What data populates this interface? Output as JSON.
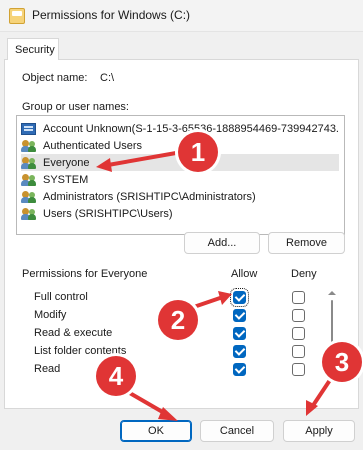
{
  "window": {
    "title": "Permissions for Windows (C:)"
  },
  "tabs": [
    {
      "label": "Security"
    }
  ],
  "object": {
    "label": "Object name:",
    "value": "C:\\"
  },
  "groups": {
    "label": "Group or user names:",
    "items": [
      {
        "label": "Account Unknown(S-1-15-3-65536-1888954469-739942743...",
        "icon": "unknown-account-icon"
      },
      {
        "label": "Authenticated Users",
        "icon": "users-icon"
      },
      {
        "label": "Everyone",
        "icon": "users-icon",
        "selected": true
      },
      {
        "label": "SYSTEM",
        "icon": "users-icon"
      },
      {
        "label": "Administrators (SRISHTIPC\\Administrators)",
        "icon": "users-icon"
      },
      {
        "label": "Users (SRISHTIPC\\Users)",
        "icon": "users-icon"
      }
    ]
  },
  "buttons": {
    "add": "Add...",
    "remove": "Remove",
    "ok": "OK",
    "cancel": "Cancel",
    "apply": "Apply"
  },
  "permissions": {
    "label": "Permissions for Everyone",
    "allow_header": "Allow",
    "deny_header": "Deny",
    "rows": [
      {
        "name": "Full control",
        "allow": true,
        "deny": false
      },
      {
        "name": "Modify",
        "allow": true,
        "deny": false
      },
      {
        "name": "Read & execute",
        "allow": true,
        "deny": false
      },
      {
        "name": "List folder contents",
        "allow": true,
        "deny": false
      },
      {
        "name": "Read",
        "allow": true,
        "deny": false
      }
    ]
  },
  "annotations": [
    {
      "number": "1",
      "color": "#e03535"
    },
    {
      "number": "2",
      "color": "#e03535"
    },
    {
      "number": "3",
      "color": "#e03535"
    },
    {
      "number": "4",
      "color": "#e03535"
    }
  ]
}
